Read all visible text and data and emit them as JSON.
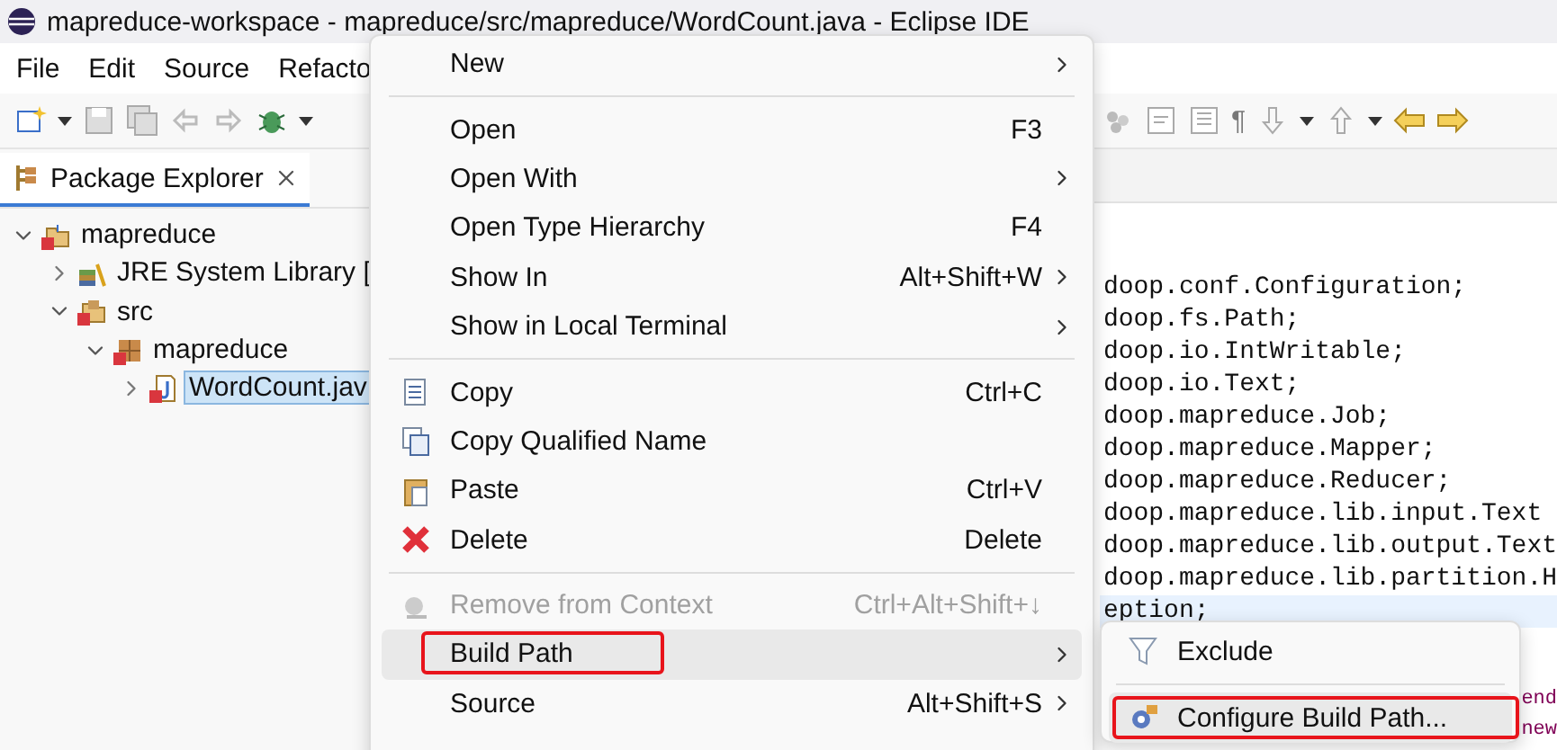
{
  "window": {
    "title": "mapreduce-workspace - mapreduce/src/mapreduce/WordCount.java - Eclipse IDE"
  },
  "menu_bar": [
    "File",
    "Edit",
    "Source",
    "Refacto"
  ],
  "toolbar": {
    "pilcrow": "¶"
  },
  "view_tab": {
    "label": "Package Explorer",
    "selected": true
  },
  "tree": [
    {
      "label": "mapreduce",
      "expanded": true,
      "selected": false,
      "children": [
        {
          "label": "JRE System Library [",
          "expanded": false,
          "selected": false
        },
        {
          "label": "src",
          "expanded": true,
          "selected": false,
          "children": [
            {
              "label": "mapreduce",
              "expanded": true,
              "selected": false,
              "children": [
                {
                  "label": "WordCount.jav",
                  "expanded": false,
                  "selected": true
                }
              ]
            }
          ]
        }
      ]
    }
  ],
  "editor": {
    "lines": [
      {
        "text": "doop.conf.Configuration;",
        "current": false
      },
      {
        "text": "doop.fs.Path;",
        "current": false
      },
      {
        "text": "doop.io.IntWritable;",
        "current": false
      },
      {
        "text": "doop.io.Text;",
        "current": false
      },
      {
        "text": "doop.mapreduce.Job;",
        "current": false
      },
      {
        "text": "doop.mapreduce.Mapper;",
        "current": false
      },
      {
        "text": "doop.mapreduce.Reducer;",
        "current": false
      },
      {
        "text": "doop.mapreduce.lib.input.Text",
        "current": false
      },
      {
        "text": "doop.mapreduce.lib.output.Text",
        "current": false
      },
      {
        "text": "doop.mapreduce.lib.partition.H",
        "current": false
      },
      {
        "text": "eption;",
        "current": true
      }
    ],
    "fragments": [
      "end",
      "new"
    ]
  },
  "context_menu": [
    {
      "kind": "item",
      "label": "New",
      "submenu": true,
      "disabled": false,
      "selected": false,
      "marked": false
    },
    {
      "kind": "separator"
    },
    {
      "kind": "item",
      "label": "Open",
      "shortcut": "F3",
      "submenu": false,
      "disabled": false,
      "selected": false,
      "marked": false
    },
    {
      "kind": "item",
      "label": "Open With",
      "submenu": true,
      "disabled": false,
      "selected": false,
      "marked": false
    },
    {
      "kind": "item",
      "label": "Open Type Hierarchy",
      "shortcut": "F4",
      "submenu": false,
      "disabled": false,
      "selected": false,
      "marked": false
    },
    {
      "kind": "item",
      "label": "Show In",
      "shortcut": "Alt+Shift+W",
      "submenu": true,
      "disabled": false,
      "selected": false,
      "marked": false
    },
    {
      "kind": "item",
      "label": "Show in Local Terminal",
      "submenu": true,
      "disabled": false,
      "selected": false,
      "marked": false
    },
    {
      "kind": "separator"
    },
    {
      "kind": "item",
      "label": "Copy",
      "shortcut": "Ctrl+C",
      "submenu": false,
      "disabled": false,
      "selected": false,
      "marked": false
    },
    {
      "kind": "item",
      "label": "Copy Qualified Name",
      "submenu": false,
      "disabled": false,
      "selected": false,
      "marked": false
    },
    {
      "kind": "item",
      "label": "Paste",
      "shortcut": "Ctrl+V",
      "submenu": false,
      "disabled": false,
      "selected": false,
      "marked": false
    },
    {
      "kind": "item",
      "label": "Delete",
      "shortcut": "Delete",
      "submenu": false,
      "disabled": false,
      "selected": false,
      "marked": false
    },
    {
      "kind": "separator"
    },
    {
      "kind": "item",
      "label": "Remove from Context",
      "shortcut": "Ctrl+Alt+Shift+↓",
      "submenu": false,
      "disabled": true,
      "selected": false,
      "marked": false
    },
    {
      "kind": "item",
      "label": "Build Path",
      "submenu": true,
      "disabled": false,
      "selected": true,
      "marked": true
    },
    {
      "kind": "item",
      "label": "Source",
      "shortcut": "Alt+Shift+S",
      "submenu": true,
      "disabled": false,
      "selected": false,
      "marked": false
    }
  ],
  "submenu": [
    {
      "kind": "item",
      "label": "Exclude",
      "selected": false,
      "marked": false
    },
    {
      "kind": "separator"
    },
    {
      "kind": "item",
      "label": "Configure Build Path...",
      "selected": true,
      "marked": true
    }
  ]
}
